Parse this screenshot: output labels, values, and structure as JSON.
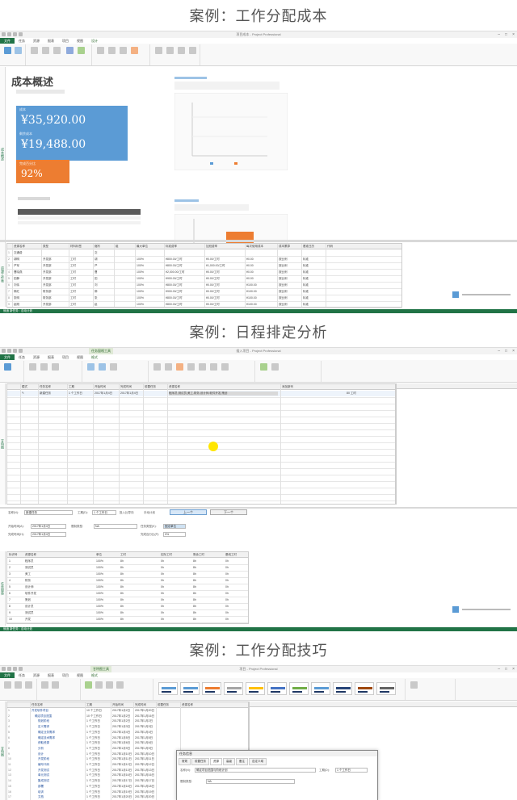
{
  "sections": [
    {
      "title": "案例：工作分配成本"
    },
    {
      "title": "案例：日程排定分析"
    },
    {
      "title": "案例：工作分配技巧"
    }
  ],
  "shot1": {
    "window_title": "项目成本 - Project Professional",
    "tabs": [
      "文件",
      "任务",
      "资源",
      "报表",
      "项目",
      "视图",
      "设计"
    ],
    "report_title": "成本概述",
    "cards": [
      {
        "label": "成本",
        "value": "¥35,920.00",
        "color": "#5b9bd5"
      },
      {
        "label": "剩余成本",
        "value": "¥19,488.00",
        "color": "#5b9bd5"
      },
      {
        "label": "完成百分比",
        "value": "92%",
        "color": "#ed7d31"
      }
    ],
    "chart_title": "成本状态",
    "status": "就绪 新任务：自动计划",
    "table_headers": [
      "资源名称",
      "类型",
      "材料标签",
      "缩写",
      "组",
      "最大单位",
      "标准费率",
      "加班费率",
      "每次使用成本",
      "成本累算",
      "基准日历",
      "代码"
    ],
    "table_rows": [
      [
        "交通费",
        "",
        "",
        "交",
        "",
        "",
        "",
        "",
        "",
        "",
        "",
        ""
      ],
      [
        "胡明",
        "开发部",
        "工时",
        "胡",
        "",
        "100%",
        "¥800.00/工时",
        "¥0.00/工时",
        "¥0.00",
        "按比例",
        "标准",
        ""
      ],
      [
        "严军",
        "开发部",
        "工时",
        "严",
        "",
        "100%",
        "¥800.00/工时",
        "¥1,000.00/工时",
        "¥0.00",
        "按比例",
        "标准",
        ""
      ],
      [
        "曹晓燕",
        "开发部",
        "工时",
        "曹",
        "",
        "100%",
        "¥2,000.00/工时",
        "¥0.00/工时",
        "¥0.00",
        "按比例",
        "标准",
        ""
      ],
      [
        "田静",
        "开发部",
        "工时",
        "田",
        "",
        "100%",
        "¥900.00/工时",
        "¥0.00/工时",
        "¥0.00",
        "按比例",
        "标准",
        ""
      ],
      [
        "刘伟",
        "开发部",
        "工时",
        "刘",
        "",
        "100%",
        "¥800.00/工时",
        "¥0.00/工时",
        "¥100.00",
        "按比例",
        "标准",
        ""
      ],
      [
        "郭红",
        "财务部",
        "工时",
        "郭",
        "",
        "100%",
        "¥900.00/工时",
        "¥0.00/工时",
        "¥100.00",
        "按比例",
        "标准",
        ""
      ],
      [
        "张明",
        "财务部",
        "工时",
        "张",
        "",
        "100%",
        "¥800.00/工时",
        "¥0.00/工时",
        "¥100.00",
        "按比例",
        "标准",
        ""
      ],
      [
        "赵刚",
        "开发部",
        "工时",
        "赵",
        "",
        "100%",
        "¥800.00/工时",
        "¥0.00/工时",
        "¥100.00",
        "按比例",
        "标准",
        ""
      ]
    ]
  },
  "shot2": {
    "window_title": "插入项目 - Project Professional",
    "ctx_tab": "任务窗格工具",
    "tabs": [
      "文件",
      "任务",
      "资源",
      "报表",
      "项目",
      "视图",
      "格式"
    ],
    "top_headers": [
      "模式",
      "任务名称",
      "工期",
      "开始时间",
      "完成时间",
      "前置任务",
      "资源名称",
      "添加新列"
    ],
    "top_row": [
      "",
      "新建任务",
      "1 个工作日",
      "2017年1月4日",
      "2017年1月4日",
      "",
      "程序员,测试员,美工,财务,设计师,软件开发,策划",
      "",
      "80 工时"
    ],
    "form": {
      "name_label": "名称(N):",
      "name_value": "新建任务",
      "duration_label": "工期(D):",
      "duration_value": "1 个工作日",
      "effort_label": "投入比导向",
      "manual_label": "手动计划",
      "prev_button": "上一个",
      "next_button": "下一个",
      "start_label": "开始时间(A):",
      "start_value": "2017年1月4日",
      "finish_label": "完成时间(H):",
      "finish_value": "2017年1月4日",
      "type_label": "任务类型(K):",
      "type_value": "固定单位",
      "complete_label": "完成百分比(P):",
      "complete_value": "0%",
      "constraint_label": "限制类型:",
      "constraint_value": "NA"
    },
    "lower_headers": [
      "标识号",
      "资源名称",
      "单位",
      "工时",
      "实际工时",
      "剩余工时",
      "基线工时"
    ],
    "lower_rows": [
      [
        "1",
        "程序员",
        "100%",
        "8h",
        "0h",
        "8h",
        "0h"
      ],
      [
        "2",
        "测试员",
        "100%",
        "8h",
        "0h",
        "8h",
        "0h"
      ],
      [
        "3",
        "美工",
        "100%",
        "8h",
        "0h",
        "8h",
        "0h"
      ],
      [
        "4",
        "财务",
        "100%",
        "8h",
        "0h",
        "8h",
        "0h"
      ],
      [
        "5",
        "设计师",
        "100%",
        "8h",
        "0h",
        "8h",
        "0h"
      ],
      [
        "6",
        "软件开发",
        "100%",
        "8h",
        "0h",
        "8h",
        "0h"
      ],
      [
        "7",
        "策划",
        "100%",
        "8h",
        "0h",
        "8h",
        "0h"
      ],
      [
        "8",
        "设计员",
        "100%",
        "8h",
        "0h",
        "8h",
        "0h"
      ],
      [
        "9",
        "测试员",
        "100%",
        "8h",
        "0h",
        "8h",
        "0h"
      ],
      [
        "10",
        "开发",
        "100%",
        "8h",
        "0h",
        "8h",
        "0h"
      ]
    ],
    "status": "就绪 新任务：自动计划"
  },
  "shot3": {
    "window_title": "项目 - Project Professional",
    "ctx_tab": "甘特图工具",
    "tabs": [
      "文件",
      "任务",
      "资源",
      "报表",
      "项目",
      "视图",
      "格式"
    ],
    "headers": [
      "任务名称",
      "工期",
      "开始时间",
      "完成时间",
      "前置任务",
      "资源名称"
    ],
    "rows": [
      [
        "开发软件项目",
        "10 个工作日",
        "2017年1月2日",
        "2017年1月20日"
      ],
      [
        "确定项目范围",
        "10 个工作日",
        "2017年1月2日",
        "2017年1月16日"
      ],
      [
        "规划阶段",
        "1 个工作日",
        "2017年1月2日",
        "2017年1月2日"
      ],
      [
        "定义需求",
        "1 个工作日",
        "2017年1月3日",
        "2017年1月3日"
      ],
      [
        "确定业务需求",
        "1 个工作日",
        "2017年1月4日",
        "2017年1月4日"
      ],
      [
        "确定技术需求",
        "1 个工作日",
        "2017年1月5日",
        "2017年1月5日"
      ],
      [
        "获取资源",
        "1 个工作日",
        "2017年1月6日",
        "2017年1月6日"
      ],
      [
        "分析",
        "1 个工作日",
        "2017年1月9日",
        "2017年1月9日"
      ],
      [
        "设计",
        "1 个工作日",
        "2017年1月10日",
        "2017年1月10日"
      ],
      [
        "开发阶段",
        "1 个工作日",
        "2017年1月11日",
        "2017年1月11日"
      ],
      [
        "编写代码",
        "1 个工作日",
        "2017年1月12日",
        "2017年1月12日"
      ],
      [
        "开发测试",
        "1 个工作日",
        "2017年1月13日",
        "2017年1月13日"
      ],
      [
        "单元测试",
        "1 个工作日",
        "2017年1月16日",
        "2017年1月16日"
      ],
      [
        "集成测试",
        "1 个工作日",
        "2017年1月17日",
        "2017年1月17日"
      ],
      [
        "部署",
        "1 个工作日",
        "2017年1月18日",
        "2017年1月18日"
      ],
      [
        "培训",
        "1 个工作日",
        "2017年1月19日",
        "2017年1月19日"
      ],
      [
        "文档",
        "1 个工作日",
        "2017年1月20日",
        "2017年1月20日"
      ]
    ],
    "dialog": {
      "title": "任务信息",
      "tabs": [
        "常规",
        "前置任务",
        "资源",
        "高级",
        "备注",
        "自定义域"
      ],
      "name_label": "名称(N):",
      "name_value": "确定项目范围与阶段计划",
      "duration_label": "工期(D):",
      "duration_value": "1 个工作日",
      "constraint_label": "限制类型:",
      "constraint_value": "NA"
    }
  }
}
